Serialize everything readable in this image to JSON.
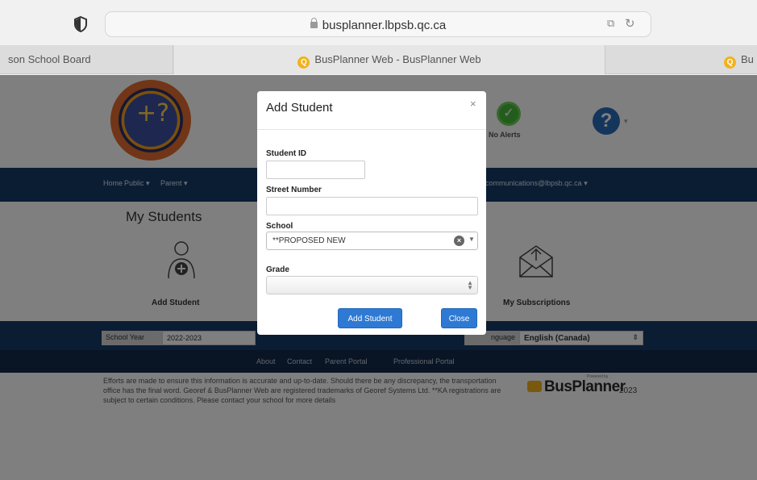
{
  "browser": {
    "url": "busplanner.lbpsb.qc.ca",
    "tabs": [
      {
        "label": "son School Board"
      },
      {
        "label": "BusPlanner Web - BusPlanner Web"
      },
      {
        "label": "Bu"
      }
    ]
  },
  "header": {
    "logo_glyph": "+?",
    "alerts_label": "No Alerts",
    "help_glyph": "?"
  },
  "nav": {
    "items": [
      "Home",
      "Public ▾",
      "Parent ▾"
    ],
    "account": "communications@lbpsb.qc.ca ▾"
  },
  "main": {
    "title": "My Students",
    "tiles": [
      {
        "label": "Add Student",
        "icon": "person-add-icon"
      },
      {
        "label": "My Subscriptions",
        "icon": "envelope-icon"
      }
    ]
  },
  "footer": {
    "school_year_label": "School Year",
    "school_year_value": "2022-2023",
    "language_label": "nguage",
    "language_value": "English (Canada)",
    "links": [
      "About",
      "Contact",
      "Parent Portal",
      "Professional Portal"
    ],
    "disclaimer": "Efforts are made to ensure this information is accurate and up-to-date. Should there be any discrepancy, the transportation office has the final word. Georef & BusPlanner Web are registered trademarks of Georef Systems Ltd. **KA registrations are subject to certain conditions. Please contact your school for more details",
    "brand": "BusPlanner",
    "powered_by": "Powered by",
    "brand_year": "2023"
  },
  "modal": {
    "title": "Add Student",
    "close_glyph": "×",
    "student_id_label": "Student ID",
    "student_id_value": "",
    "street_number_label": "Street Number",
    "street_number_value": "",
    "school_label": "School",
    "school_value": "**PROPOSED NEW",
    "grade_label": "Grade",
    "grade_value": "",
    "submit_label": "Add Student",
    "close_label": "Close"
  },
  "colors": {
    "navbar": "#163a66",
    "primary_button": "#2e79d4"
  }
}
